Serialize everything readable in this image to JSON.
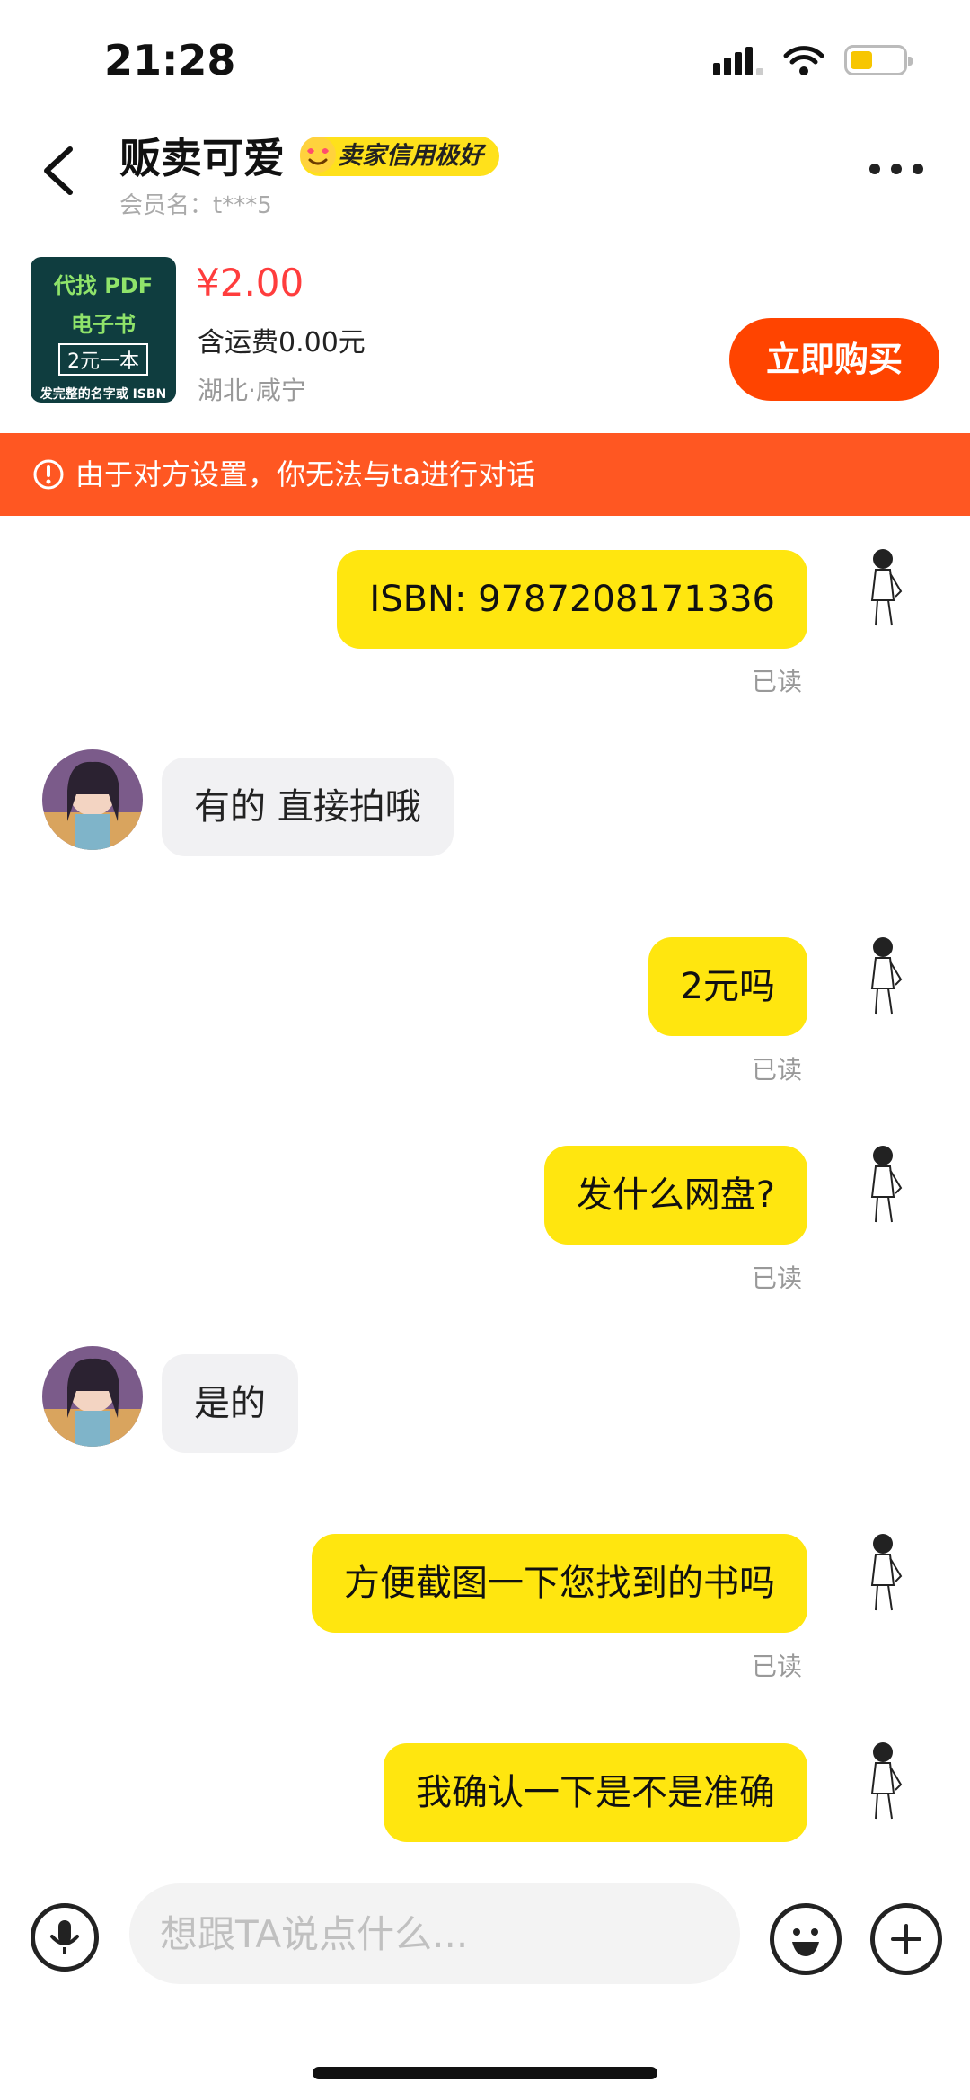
{
  "status_bar": {
    "time": "21:28"
  },
  "header": {
    "seller_name": "贩卖可爱",
    "credit_badge": "卖家信用极好",
    "member_label": "会员名：t***5"
  },
  "product": {
    "image_text": {
      "line1": "代找 PDF",
      "line2": "电子书",
      "line3": "2元一本",
      "line4": "发完整的名字或 ISBN"
    },
    "price": "¥2.00",
    "shipping": "含运费0.00元",
    "location": "湖北·咸宁",
    "buy_label": "立即购买"
  },
  "warning": {
    "text": "由于对方设置，你无法与ta进行对话"
  },
  "messages": [
    {
      "from": "me",
      "text": "ISBN: 9787208171336",
      "status": "已读"
    },
    {
      "from": "them",
      "text": "有的 直接拍哦"
    },
    {
      "from": "me",
      "text": "2元吗",
      "status": "已读"
    },
    {
      "from": "me",
      "text": "发什么网盘?",
      "status": "已读"
    },
    {
      "from": "them",
      "text": "是的"
    },
    {
      "from": "me",
      "text": "方便截图一下您找到的书吗",
      "status": "已读"
    },
    {
      "from": "me",
      "text": "我确认一下是不是准确"
    }
  ],
  "input": {
    "placeholder": "想跟TA说点什么..."
  },
  "colors": {
    "accent": "#ff4400",
    "bubble_me": "#ffe60f",
    "warning": "#ff5722",
    "price": "#ff3d3d"
  }
}
